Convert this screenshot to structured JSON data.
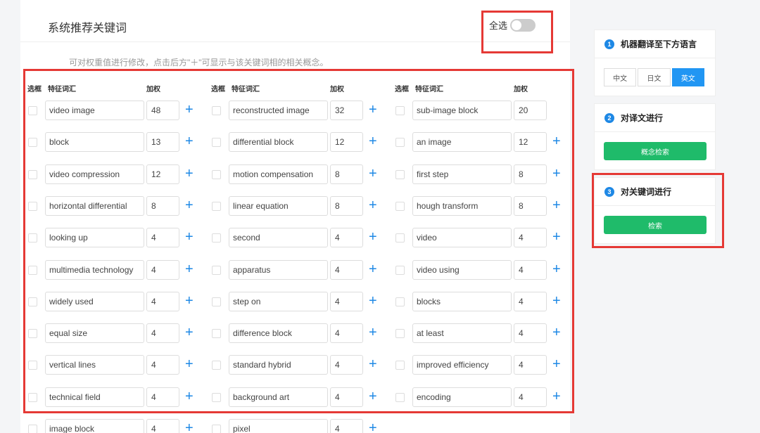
{
  "panel": {
    "title": "系统推荐关键词",
    "select_all_label": "全选",
    "hint": "可对权重值进行修改，点击后方\"＋\"可显示与该关键词相的相关概念。"
  },
  "columns": {
    "checkbox_header": "选框",
    "keyword_header": "特征词汇",
    "weight_header": "加权"
  },
  "keywords": [
    [
      {
        "term": "video image",
        "weight": "48"
      },
      {
        "term": "reconstructed image",
        "weight": "32"
      },
      {
        "term": "sub-image block",
        "weight": "20"
      }
    ],
    [
      {
        "term": "block",
        "weight": "13"
      },
      {
        "term": "differential block",
        "weight": "12"
      },
      {
        "term": "an image",
        "weight": "12"
      }
    ],
    [
      {
        "term": "video compression",
        "weight": "12"
      },
      {
        "term": "motion compensation",
        "weight": "8"
      },
      {
        "term": "first step",
        "weight": "8"
      }
    ],
    [
      {
        "term": "horizontal differential",
        "weight": "8"
      },
      {
        "term": "linear equation",
        "weight": "8"
      },
      {
        "term": "hough transform",
        "weight": "8"
      }
    ],
    [
      {
        "term": "looking up",
        "weight": "4"
      },
      {
        "term": "second",
        "weight": "4"
      },
      {
        "term": "video",
        "weight": "4"
      }
    ],
    [
      {
        "term": "multimedia technology",
        "weight": "4"
      },
      {
        "term": "apparatus",
        "weight": "4"
      },
      {
        "term": "video using",
        "weight": "4"
      }
    ],
    [
      {
        "term": "widely used",
        "weight": "4"
      },
      {
        "term": "step on",
        "weight": "4"
      },
      {
        "term": "blocks",
        "weight": "4"
      }
    ],
    [
      {
        "term": "equal size",
        "weight": "4"
      },
      {
        "term": "difference block",
        "weight": "4"
      },
      {
        "term": "at least",
        "weight": "4"
      }
    ],
    [
      {
        "term": "vertical lines",
        "weight": "4"
      },
      {
        "term": "standard hybrid",
        "weight": "4"
      },
      {
        "term": "improved efficiency",
        "weight": "4"
      }
    ],
    [
      {
        "term": "technical field",
        "weight": "4"
      },
      {
        "term": "background art",
        "weight": "4"
      },
      {
        "term": "encoding",
        "weight": "4"
      }
    ],
    [
      {
        "term": "image block",
        "weight": "4"
      },
      {
        "term": "pixel",
        "weight": "4"
      }
    ]
  ],
  "sidebar": {
    "step1": {
      "num": "1",
      "title": "机器翻译至下方语言",
      "langs": [
        "中文",
        "日文",
        "英文"
      ],
      "active": "英文"
    },
    "step2": {
      "num": "2",
      "title": "对译文进行",
      "button": "概念检索"
    },
    "step3": {
      "num": "3",
      "title": "对关键词进行",
      "button": "检索"
    }
  },
  "colors": {
    "accent": "#1e88e5",
    "green": "#1fbb6a",
    "highlight": "#e53935"
  }
}
